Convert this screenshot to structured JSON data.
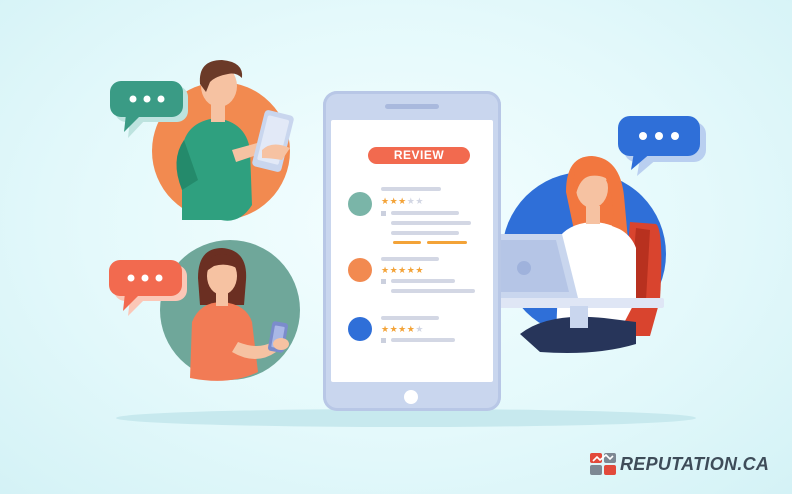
{
  "phone": {
    "badge": "REVIEW",
    "reviews": [
      {
        "rating": 3,
        "max": 5,
        "avatar_color": "#7ab5a8"
      },
      {
        "rating": 5,
        "max": 5,
        "avatar_color": "#f28a50"
      },
      {
        "rating": 4,
        "max": 5,
        "avatar_color": "#2f6fd8"
      }
    ]
  },
  "people": [
    {
      "name": "man-with-tablet",
      "circle_color": "#f28a50",
      "bubble_color": "#3a9b85"
    },
    {
      "name": "woman-with-phone",
      "circle_color": "#6fa79a",
      "bubble_color": "#f26a4f"
    },
    {
      "name": "woman-with-laptop",
      "circle_color": "#2f6fd8",
      "bubble_color": "#2f6fd8"
    }
  ],
  "brand": {
    "text": "REPUTATION.CA"
  }
}
